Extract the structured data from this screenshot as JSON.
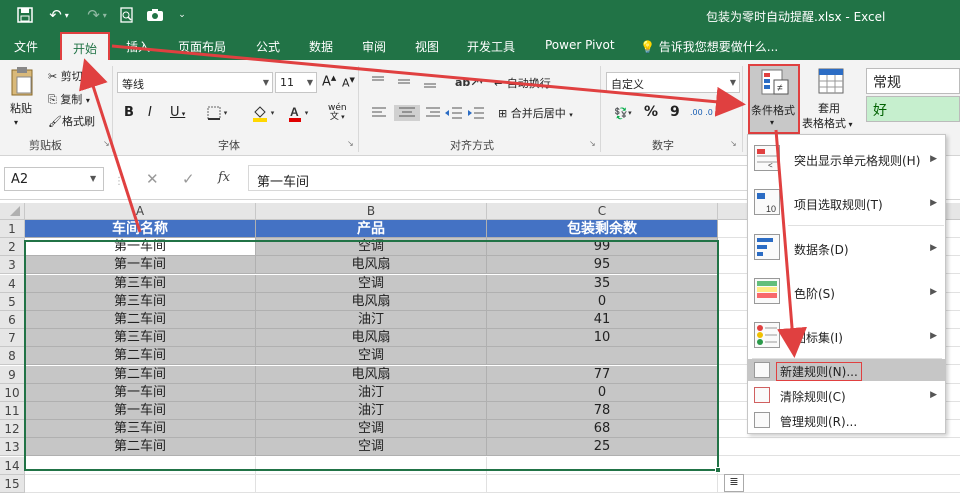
{
  "window": {
    "title": "包装为零时自动提醒.xlsx - Excel"
  },
  "quick_access": {
    "save": "save-icon",
    "undo": "undo-icon",
    "redo": "redo-icon",
    "preview": "print-preview-icon",
    "camera": "camera-icon",
    "more": "customize-icon"
  },
  "menu": {
    "tabs": [
      "文件",
      "开始",
      "插入",
      "页面布局",
      "公式",
      "数据",
      "审阅",
      "视图",
      "开发工具",
      "Power Pivot"
    ],
    "active": "开始",
    "tellme": "告诉我您想要做什么..."
  },
  "ribbon": {
    "clipboard": {
      "paste": "粘贴",
      "cut": "剪切",
      "copy": "复制",
      "painter": "格式刷",
      "label": "剪贴板"
    },
    "font": {
      "name": "等线",
      "size": "11",
      "bold": "B",
      "italic": "I",
      "underline": "U",
      "grow": "A",
      "shrink": "A",
      "wen": "wén",
      "label": "字体"
    },
    "align": {
      "wrap": "自动换行",
      "merge": "合并后居中",
      "label": "对齐方式"
    },
    "number": {
      "format": "自定义",
      "percent": "%",
      "comma": "9",
      "inc": ".00 .0",
      "label": "数字"
    },
    "styles": {
      "cond": "条件格式",
      "table1": "套用",
      "table2": "表格格式",
      "normal": "常规",
      "good": "好"
    }
  },
  "formula_bar": {
    "name_box": "A2",
    "fx": "fx",
    "content": "第一车间"
  },
  "columns": [
    "A",
    "B",
    "C"
  ],
  "rows": [
    "1",
    "2",
    "3",
    "4",
    "5",
    "6",
    "7",
    "8",
    "9",
    "10",
    "11",
    "12",
    "13",
    "14",
    "15"
  ],
  "table": {
    "headers": [
      "车间名称",
      "产品",
      "包装剩余数"
    ],
    "data": [
      [
        "第一车间",
        "空调",
        "99"
      ],
      [
        "第一车间",
        "电风扇",
        "95"
      ],
      [
        "第三车间",
        "空调",
        "35"
      ],
      [
        "第三车间",
        "电风扇",
        "0"
      ],
      [
        "第二车间",
        "油汀",
        "41"
      ],
      [
        "第三车间",
        "电风扇",
        "10"
      ],
      [
        "第二车间",
        "空调",
        ""
      ],
      [
        "第二车间",
        "电风扇",
        "77"
      ],
      [
        "第一车间",
        "油汀",
        "0"
      ],
      [
        "第一车间",
        "油汀",
        "78"
      ],
      [
        "第三车间",
        "空调",
        "68"
      ],
      [
        "第二车间",
        "空调",
        "25"
      ]
    ]
  },
  "cond_menu": {
    "items": [
      {
        "label": "突出显示单元格规则(H)",
        "icon": "highlight-rules-icon"
      },
      {
        "label": "项目选取规则(T)",
        "icon": "top-bottom-rules-icon"
      },
      {
        "label": "数据条(D)",
        "icon": "data-bars-icon"
      },
      {
        "label": "色阶(S)",
        "icon": "color-scales-icon"
      },
      {
        "label": "图标集(I)",
        "icon": "icon-sets-icon"
      }
    ],
    "small": [
      {
        "label": "新建规则(N)...",
        "icon": "new-rule-icon"
      },
      {
        "label": "清除规则(C)",
        "icon": "clear-rules-icon"
      },
      {
        "label": "管理规则(R)...",
        "icon": "manage-rules-icon"
      }
    ]
  },
  "colors": {
    "excel_green": "#217346",
    "header_blue": "#4472c4",
    "highlight_red": "#e04040",
    "cell_gray": "#c6c6c6"
  }
}
